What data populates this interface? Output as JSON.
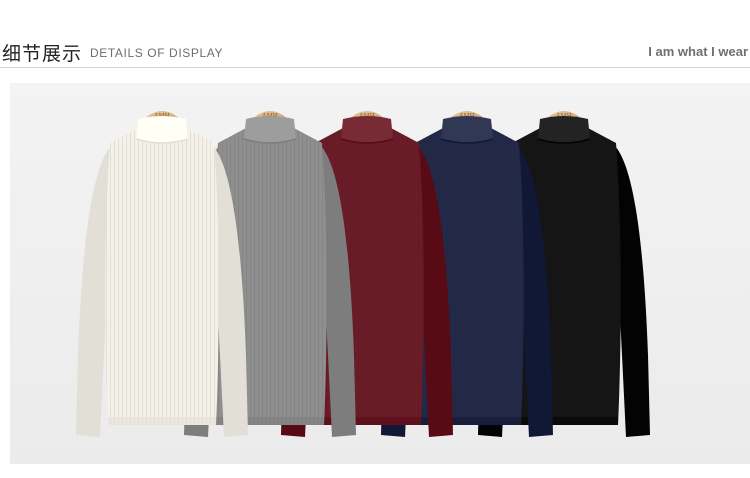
{
  "header": {
    "title_cn": "细节展示",
    "title_en": "DETAILS OF DISPLAY",
    "slogan": "I am what I wear"
  },
  "photo": {
    "hanger_brand": "AMH",
    "sweaters": [
      {
        "color_name": "white",
        "color": "#f4f1e8"
      },
      {
        "color_name": "gray",
        "color": "#8f8f8f"
      },
      {
        "color_name": "burgundy",
        "color": "#6a1c27"
      },
      {
        "color_name": "navy",
        "color": "#232a48"
      },
      {
        "color_name": "black",
        "color": "#151515"
      }
    ]
  }
}
